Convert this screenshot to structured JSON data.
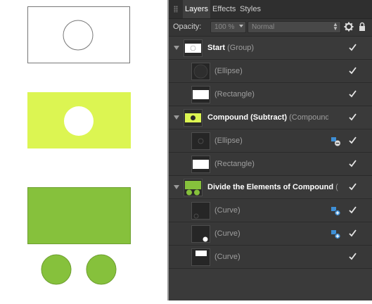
{
  "panel": {
    "tabs": [
      {
        "label": "Layers",
        "active": true
      },
      {
        "label": "Effects",
        "active": false
      },
      {
        "label": "Styles",
        "active": false
      }
    ],
    "opacity_label": "Opacity:",
    "opacity_value": "100 %",
    "blend_mode": "Normal"
  },
  "layers": [
    {
      "name": "Start",
      "type": "(Group)",
      "bold": true,
      "level": 0,
      "visible": true
    },
    {
      "name": "",
      "type": "(Ellipse)",
      "level": 1,
      "visible": true
    },
    {
      "name": "",
      "type": "(Rectangle)",
      "level": 1,
      "visible": true
    },
    {
      "name": "Compound (Subtract)",
      "type": "(Compound)",
      "bold": true,
      "level": 0,
      "visible": true
    },
    {
      "name": "",
      "type": "(Ellipse)",
      "level": 1,
      "visible": true,
      "op_icon": "subtract-icon"
    },
    {
      "name": "",
      "type": "(Rectangle)",
      "level": 1,
      "visible": true
    },
    {
      "name": "Divide the Elements of Compound",
      "type": "(C",
      "bold": true,
      "level": 0,
      "visible": true
    },
    {
      "name": "",
      "type": "(Curve)",
      "level": 1,
      "visible": true,
      "op_icon": "add-icon"
    },
    {
      "name": "",
      "type": "(Curve)",
      "level": 1,
      "visible": true,
      "op_icon": "add-icon"
    },
    {
      "name": "",
      "type": "(Curve)",
      "level": 1,
      "visible": true
    }
  ],
  "colors": {
    "lime": "#dcf552",
    "green": "#86c13c",
    "panel_bg": "#3a3a3a",
    "op_icon_blue": "#3e8fd6"
  }
}
